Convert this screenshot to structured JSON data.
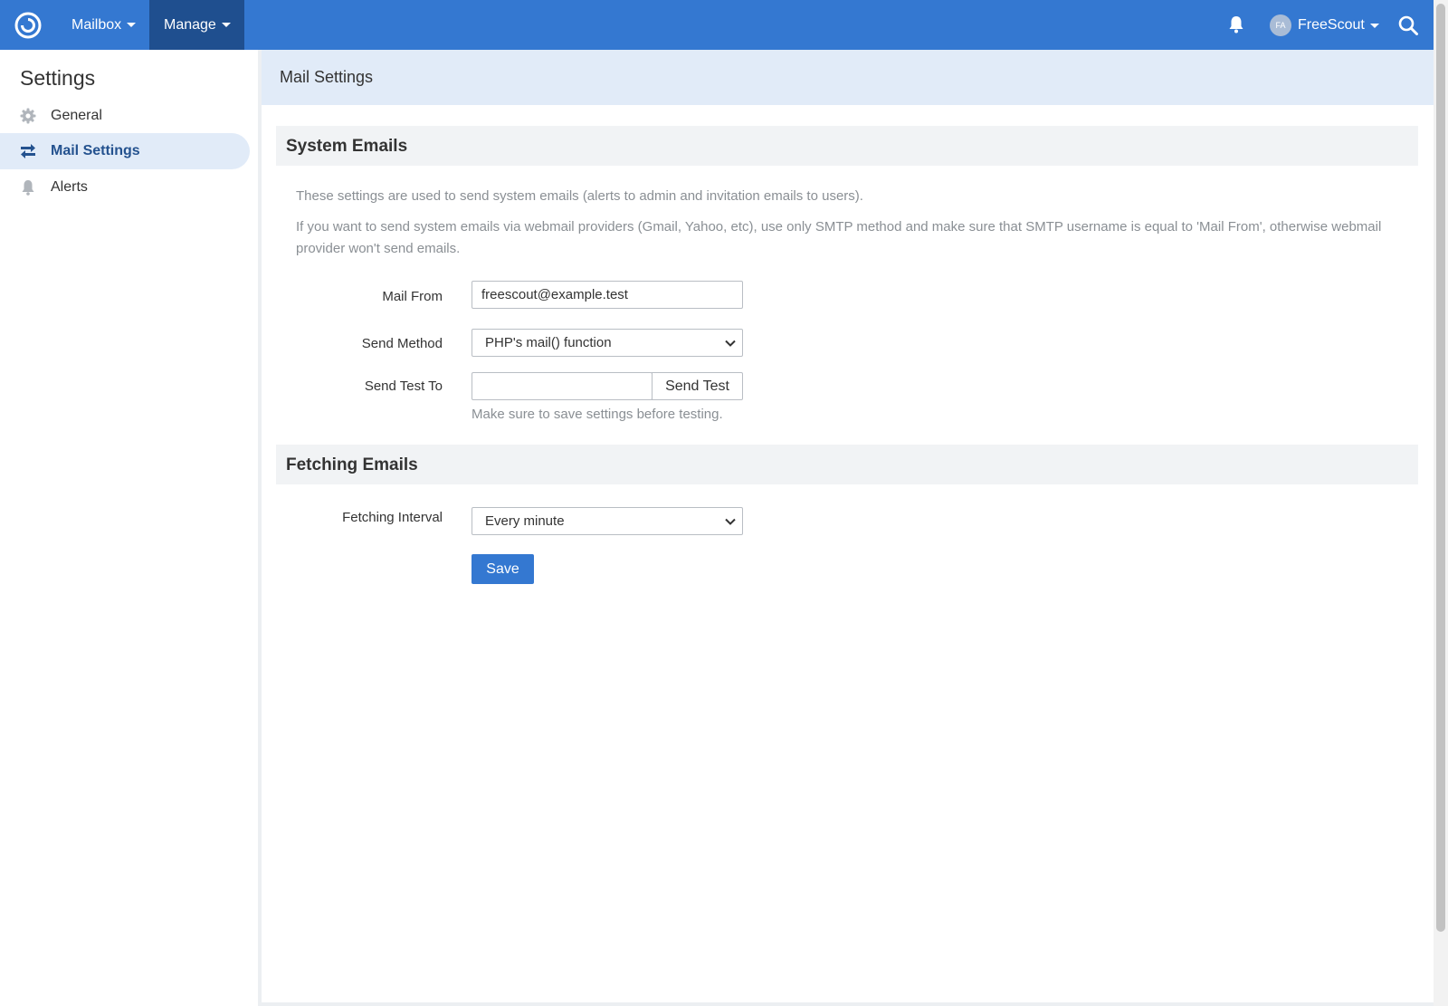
{
  "nav": {
    "mailbox_label": "Mailbox",
    "manage_label": "Manage",
    "user_initials": "FA",
    "user_name": "FreeScout",
    "brand_color": "#3478d1",
    "active_nav_color": "#1f4f8f"
  },
  "sidebar": {
    "title": "Settings",
    "items": [
      {
        "label": "General",
        "icon": "gear-icon"
      },
      {
        "label": "Mail Settings",
        "icon": "exchange-icon",
        "active": true
      },
      {
        "label": "Alerts",
        "icon": "bell-icon"
      }
    ]
  },
  "main": {
    "page_title": "Mail Settings",
    "system_emails": {
      "heading": "System Emails",
      "desc1": "These settings are used to send system emails (alerts to admin and invitation emails to users).",
      "desc2": "If you want to send system emails via webmail providers (Gmail, Yahoo, etc), use only SMTP method and make sure that SMTP username is equal to 'Mail From', otherwise webmail provider won't send emails.",
      "mail_from_label": "Mail From",
      "mail_from_value": "freescout@example.test",
      "send_method_label": "Send Method",
      "send_method_value": "PHP's mail() function",
      "send_test_label": "Send Test To",
      "send_test_value": "",
      "send_test_button": "Send Test",
      "help_text": "Make sure to save settings before testing."
    },
    "fetching_emails": {
      "heading": "Fetching Emails",
      "interval_label": "Fetching Interval",
      "interval_value": "Every minute"
    },
    "save_button": "Save"
  }
}
